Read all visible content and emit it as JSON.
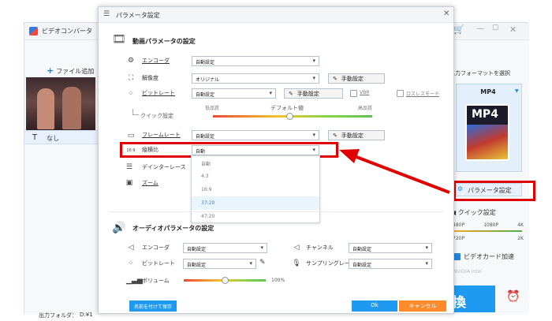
{
  "app": {
    "title": "ビデオコンバータ",
    "add_file": "ファイル追加",
    "subtitle_value": "なし",
    "output_folder_label": "出力フォルダ：",
    "output_folder_value": "D:¥1",
    "format_title": "出力フォーマットを選択",
    "format_name": "MP4",
    "format_icon_text": "MP4",
    "param_button": "パラメータ設定",
    "quick_settings": "クイック設定",
    "quick_ticks_top": [
      "480P",
      "1080P",
      "4K"
    ],
    "quick_ticks_bottom": [
      "720P",
      "2K"
    ],
    "gpu_label": "ビデオカード加速",
    "gpu_logos": "NVIDIA   intel",
    "convert_label": "換"
  },
  "dialog": {
    "title": "パラメータ設定",
    "video_section_title": "動画パラメータの設定",
    "audio_section_title": "オーディオパラメータの設定",
    "video": {
      "encoder_label": "エンコーダ",
      "encoder_value": "自動設定",
      "resolution_label": "解像度",
      "resolution_value": "オリジナル",
      "manual_setting": "手動設定",
      "bitrate_label": "ビットレート",
      "bitrate_value": "自動設定",
      "vbr_label": "VBR",
      "lossless_label": "ロスレスモード",
      "quality_low": "低品質",
      "quality_default": "デフォルト値",
      "quality_high": "高品質",
      "quick_setting": "クイック設定",
      "framerate_label": "フレームレート",
      "framerate_value": "自動設定",
      "aspect_label": "縦横比",
      "aspect_value": "自動",
      "deinterlace_label": "デインターレース",
      "zoom_label": "ズーム",
      "aspect_options": [
        "自動",
        "4:3",
        "16:9",
        "37:20",
        "47:20"
      ],
      "aspect_highlighted": "37:20"
    },
    "audio": {
      "encoder_label": "エンコーダ",
      "encoder_value": "自動設定",
      "channel_label": "チャンネル",
      "channel_value": "自動設定",
      "bitrate_label": "ビットレート",
      "bitrate_value": "自動設定",
      "samplerate_label": "サンプリングレート",
      "samplerate_value": "自動設定",
      "volume_label": "ボリューム",
      "volume_value": "100%"
    },
    "save_name_button": "名前を付けて保存",
    "ok_button": "Ok",
    "cancel_button": "キャンセル"
  },
  "colors": {
    "accent": "#1e9bf0",
    "cancel": "#ff8a2a",
    "highlight": "#e00000"
  }
}
